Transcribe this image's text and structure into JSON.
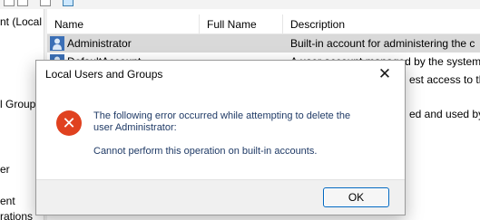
{
  "tree": {
    "items": [
      {
        "label": "nt (Local"
      },
      {
        "label": "l Groups"
      },
      {
        "label": "er"
      },
      {
        "label": "ent"
      },
      {
        "label": "rations"
      }
    ]
  },
  "list": {
    "columns": [
      "Name",
      "Full Name",
      "Description"
    ],
    "rows": [
      {
        "name": "Administrator",
        "full_name": "",
        "description": "Built-in account for administering the c"
      },
      {
        "name": "DefaultAccount",
        "full_name": "",
        "description": "A user account managed by the system"
      },
      {
        "name": "",
        "full_name": "",
        "description": "est access to the"
      },
      {
        "name": "",
        "full_name": "",
        "description": "ed and used by th"
      }
    ]
  },
  "dialog": {
    "title": "Local Users and Groups",
    "close_icon": "close-icon",
    "error_icon": "error-icon",
    "message_line1": "The following error occurred while attempting to delete the",
    "message_line2": "user Administrator:",
    "message_detail": "Cannot perform this operation on built-in accounts.",
    "ok_label": "OK"
  },
  "colors": {
    "error": "#e0411f",
    "accent": "#0067c0",
    "message_text": "#1f3a66"
  }
}
